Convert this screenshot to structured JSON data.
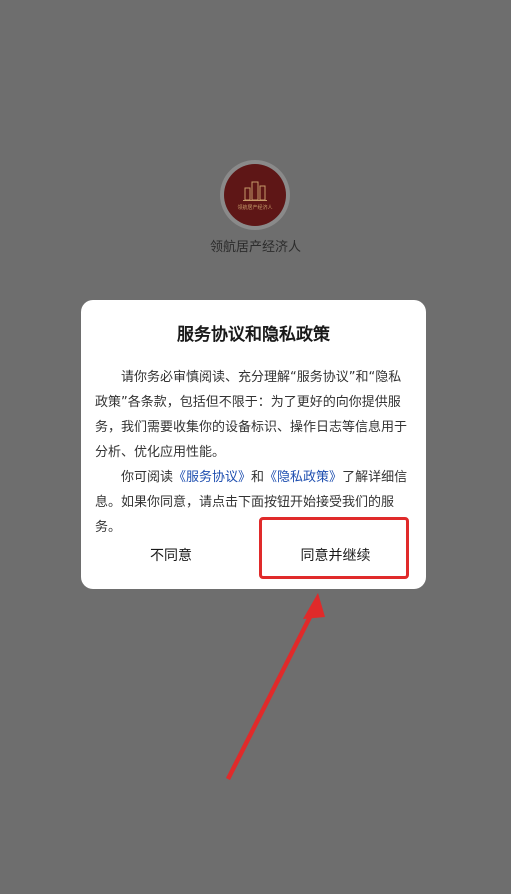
{
  "splash": {
    "logo_text": "领航居产经济人",
    "app_name": "领航居产经济人"
  },
  "dialog": {
    "title": "服务协议和隐私政策",
    "paragraph1": "请你务必审慎阅读、充分理解“服务协议”和“隐私政策”各条款，包括但不限于：为了更好的向你提供服务，我们需要收集你的设备标识、操作日志等信息用于分析、优化应用性能。",
    "p2_prefix": "你可阅读",
    "service_link": "《服务协议》",
    "p2_and": "和",
    "privacy_link": "《隐私政策》",
    "p2_suffix": "了解详细信息。如果你同意，请点击下面按钮开始接受我们的服务。",
    "disagree_label": "不同意",
    "agree_label": "同意并继续"
  },
  "colors": {
    "overlay": "#6e6e6e",
    "link": "#1f4fb0",
    "annotation": "#e02a2a"
  }
}
